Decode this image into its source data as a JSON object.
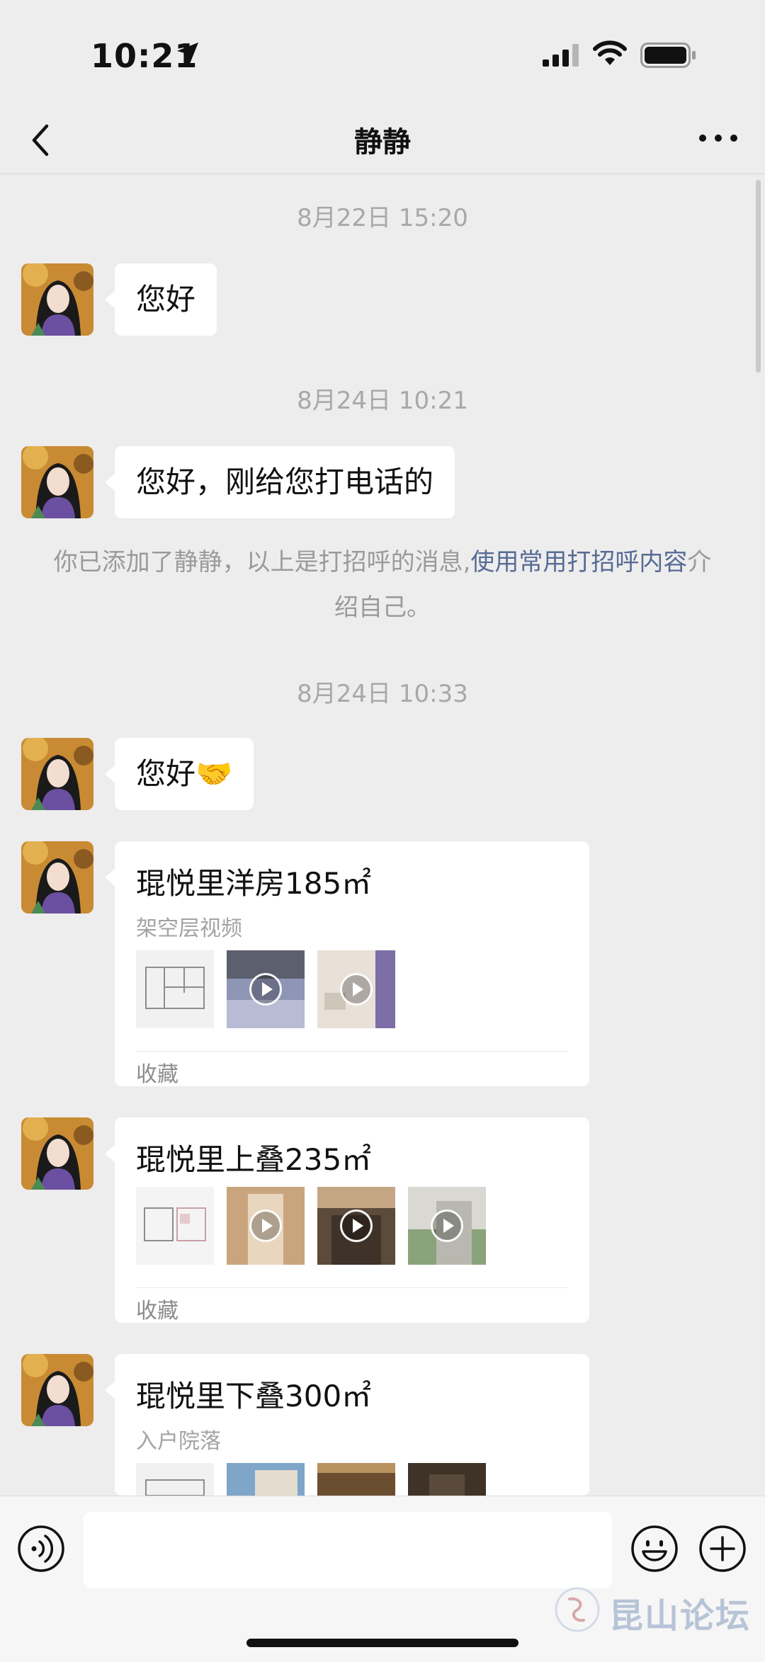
{
  "status_bar": {
    "time": "10:21"
  },
  "header": {
    "title": "静静"
  },
  "messages": {
    "ts1": "8月22日 15:20",
    "msg1": "您好",
    "ts2": "8月24日 10:21",
    "msg2": "您好，刚给您打电话的",
    "system_note": {
      "prefix": "你已添加了静静，以上是打招呼的消息,",
      "link": "使用常用打招呼内容",
      "suffix": "介绍自己。"
    },
    "ts3": "8月24日 10:33",
    "msg3": "您好🤝"
  },
  "cards": [
    {
      "title": "琨悦里洋房185㎡",
      "subtitle": "架空层视频",
      "footer": "收藏"
    },
    {
      "title": "琨悦里上叠235㎡",
      "footer": "收藏"
    },
    {
      "title": "琨悦里下叠300㎡",
      "subtitle": "入户院落"
    }
  ],
  "watermark": "昆山论坛",
  "icons": {
    "back": "chevron-left-icon",
    "more": "more-dots-icon",
    "voice": "voice-icon",
    "emoji": "emoji-icon",
    "plus": "plus-icon"
  }
}
